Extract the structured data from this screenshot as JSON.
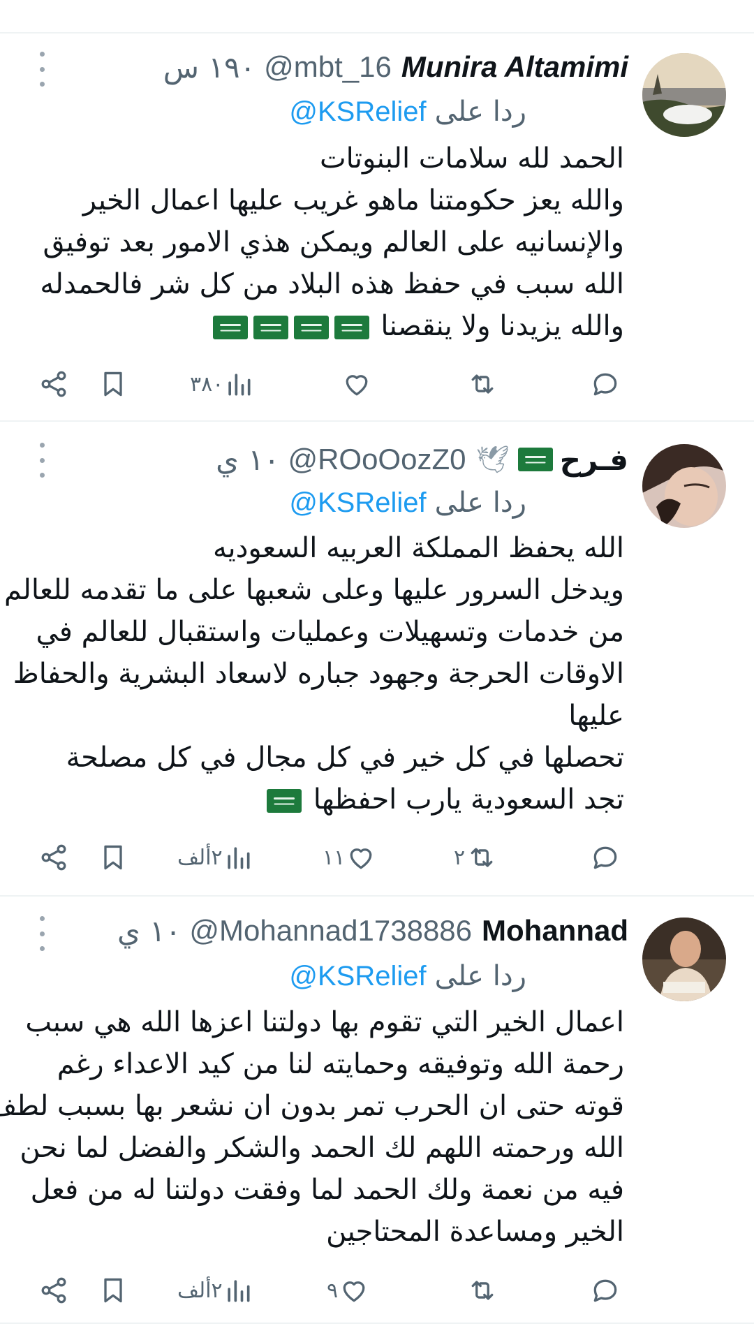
{
  "tweets": [
    {
      "name": "Munira Altamimi",
      "handle": "@mbt_16",
      "time": "١٩٠ س",
      "reply_prefix": "ردا على",
      "reply_mention": "@KSRelief",
      "lines": [
        "الحمد لله سلامات البنوتات",
        "والله  يعز حكومتنا   ماهو غريب عليها  اعمال الخير",
        "والإنسانيه على العالم ويمكن هذي الامور بعد توفيق",
        "الله سبب في حفظ هذه البلاد من كل شر   فالحمدله",
        "والله يزيدنا ولا ينقصنا"
      ],
      "line_flags": [
        0,
        0,
        0,
        0,
        4
      ],
      "replies": "",
      "retweets": "",
      "likes": "",
      "views": "٣٨٠"
    },
    {
      "name": "فـرح",
      "handle": "@ROoOozZ0",
      "time": "١٠ ي",
      "reply_prefix": "ردا على",
      "reply_mention": "@KSRelief",
      "lines": [
        "الله يحفظ المملكة  العربيه السعوديه",
        "ويدخل السرور عليها وعلى شعبها على ما تقدمه للعالم",
        "من خدمات وتسهيلات وعمليات واستقبال للعالم في",
        "الاوقات الحرجة وجهود جباره لاسعاد البشرية والحفاظ",
        "عليها",
        "تحصلها في كل خير في كل مجال   في كل  مصلحة",
        "تجد السعودية يارب احفظها"
      ],
      "line_flags": [
        0,
        0,
        0,
        0,
        0,
        0,
        1
      ],
      "replies": "",
      "retweets": "٢",
      "likes": "١١",
      "views": "٢ألف"
    },
    {
      "name": "Mohannad",
      "handle": "@Mohannad1738886",
      "time": "١٠ ي",
      "reply_prefix": "ردا على",
      "reply_mention": "@KSRelief",
      "lines": [
        "اعمال الخير التي تقوم بها دولتنا اعزها الله هي سبب",
        "رحمة الله وتوفيقه وحمايته لنا من كيد الاعداء رغم",
        "قوته حتى ان الحرب تمر بدون ان نشعر بها بسبب لطف",
        "الله ورحمته اللهم لك الحمد والشكر والفضل لما نحن",
        "فيه من نعمة ولك الحمد لما وفقت دولتنا له من فعل",
        "الخير ومساعدة المحتاجين"
      ],
      "line_flags": [
        0,
        0,
        0,
        0,
        0,
        0
      ],
      "replies": "",
      "retweets": "",
      "likes": "٩",
      "views": "٢ألف"
    }
  ],
  "icons": {
    "share": "share-icon",
    "bookmark": "bookmark-icon",
    "views": "views-chart-icon",
    "like": "heart-icon",
    "retweet": "retweet-icon",
    "reply": "reply-bubble-icon",
    "more": "more-vertical-icon"
  },
  "colors": {
    "text": "#0f1419",
    "muted": "#536471",
    "link": "#1d9bf0",
    "divider": "#eff3f4",
    "flag_green": "#1d7a3c"
  }
}
